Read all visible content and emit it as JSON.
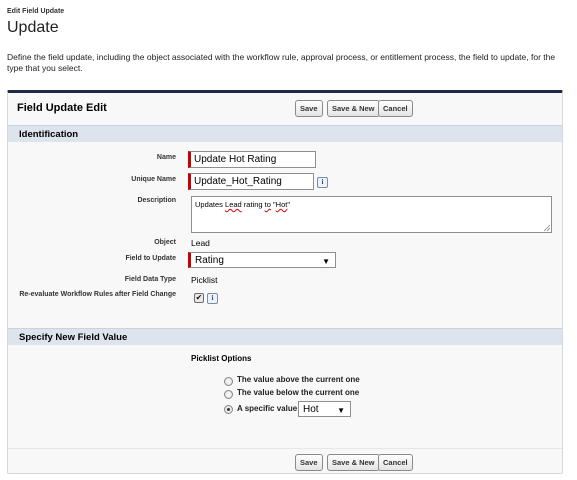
{
  "header": {
    "subtitle": "Edit Field Update",
    "title": "Update",
    "description": "Define the field update, including the object associated with the workflow rule, approval process, or entitlement process, the field to update, for the type that you select."
  },
  "panel": {
    "title": "Field Update Edit",
    "buttons": {
      "save": "Save",
      "save_new": "Save & New",
      "cancel": "Cancel"
    },
    "identification": {
      "section_title": "Identification",
      "name_label": "Name",
      "name_value": "Update Hot Rating",
      "unique_name_label": "Unique Name",
      "unique_name_value": "Update_Hot_Rating",
      "description_label": "Description",
      "description_parts": [
        "Updates ",
        "Lead",
        " rating ",
        "to",
        " \"",
        "Hot",
        "\""
      ],
      "object_label": "Object",
      "object_value": "Lead",
      "field_to_update_label": "Field to Update",
      "field_to_update_value": "Rating",
      "field_data_type_label": "Field Data Type",
      "field_data_type_value": "Picklist",
      "reevaluate_label": "Re-evaluate Workflow Rules after Field Change",
      "reevaluate_checked": true,
      "info_icon": "i"
    },
    "new_value": {
      "section_title": "Specify New Field Value",
      "picklist_options_label": "Picklist Options",
      "options": [
        {
          "label": "The value above the current one",
          "checked": false
        },
        {
          "label": "The value below the current one",
          "checked": false
        },
        {
          "label": "A specific value",
          "checked": true
        }
      ],
      "specific_value": "Hot"
    }
  },
  "icons": {
    "info": "info-icon",
    "dropdown": "chevron-down-icon",
    "check": "checkmark-icon"
  },
  "colors": {
    "required_bar": "#cc0000",
    "section_bg": "#dde4ee",
    "panel_top_border": "#1f2a44"
  }
}
